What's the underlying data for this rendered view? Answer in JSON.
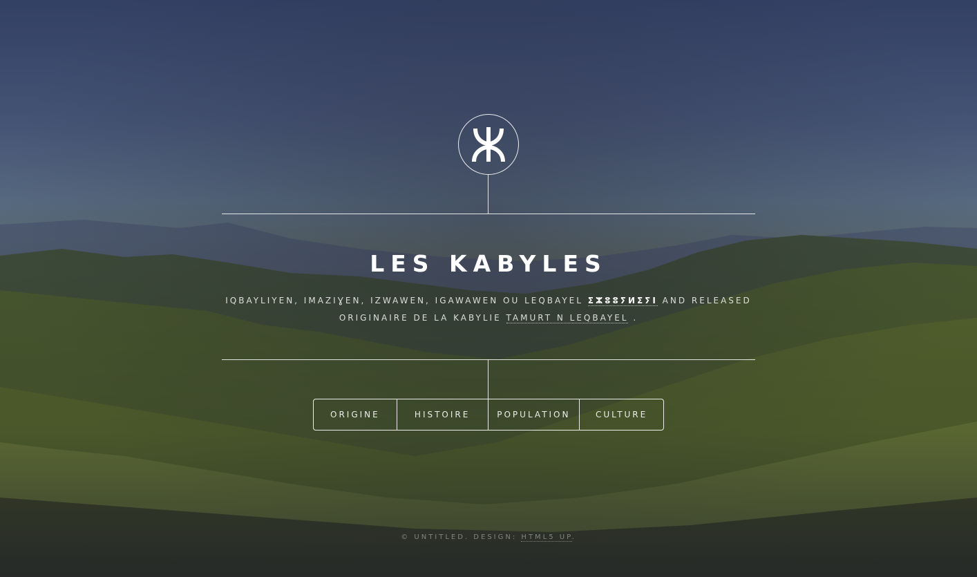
{
  "header": {
    "logo_icon": "yaz-tifinagh-icon",
    "title": "Les Kabyles",
    "subtitle": {
      "part1": "Iqbayliyen, Imaziɣen, Izwawen, Igawawen ou Leqbayel",
      "tifinagh": "ⵉⵣⵓⵓⵢⵍⵉⵢⵏ",
      "part2": "and released",
      "part3": "originaire de la Kabylie",
      "link": "Tamurt n Leqbayel",
      "end": "."
    }
  },
  "nav": {
    "items": [
      {
        "label": "Origine"
      },
      {
        "label": "Histoire"
      },
      {
        "label": "Population"
      },
      {
        "label": "Culture"
      }
    ]
  },
  "footer": {
    "copyright": "© Untitled. Design:",
    "design_link": "HTML5 UP",
    "end": "."
  }
}
